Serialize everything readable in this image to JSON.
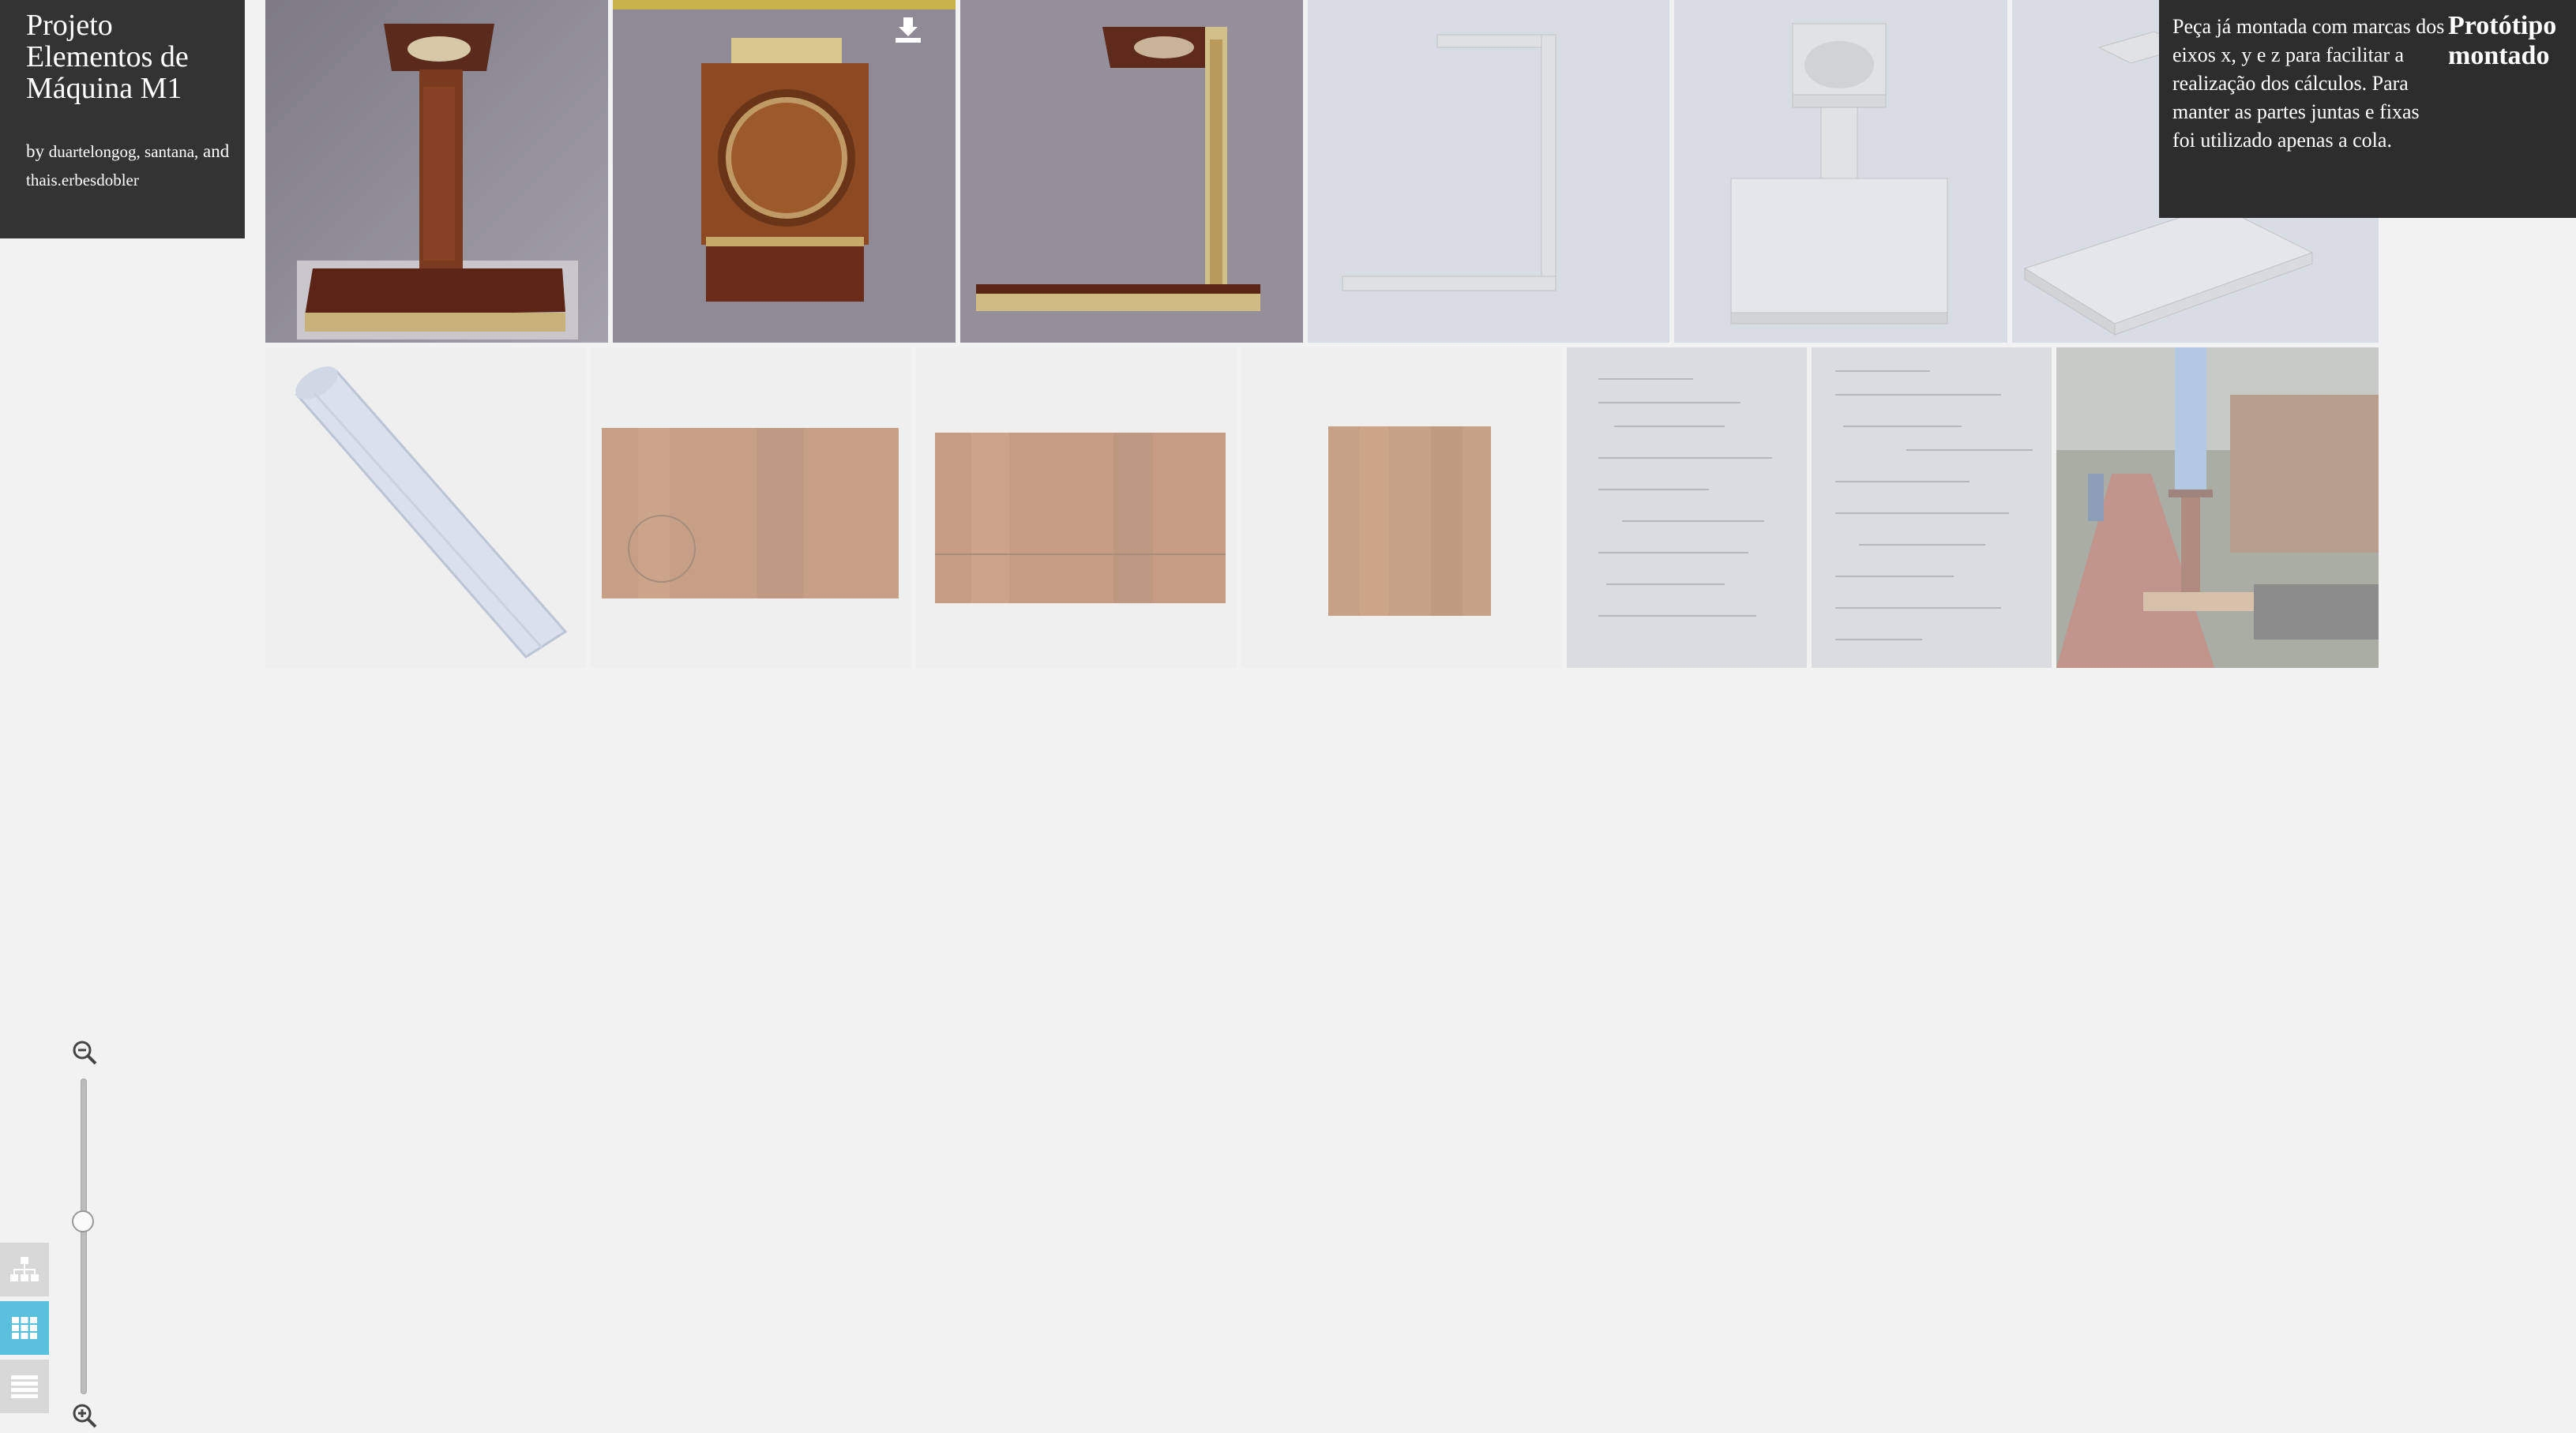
{
  "project": {
    "title": "Projeto Elementos de Máquina M1",
    "by_prefix": "by",
    "authors": "duartelongog, santana,",
    "and_word": "and",
    "last_author": "thais.erbesdobler"
  },
  "info": {
    "heading": "Protótipo montado",
    "description": "Peça já montada com marcas dos eixos x, y e z para facilitar a realização dos cálculos. Para manter as partes juntas e fixas foi utilizado apenas a cola."
  },
  "gallery": {
    "row1": [
      {
        "name": "photo-assembled-front",
        "active": true
      },
      {
        "name": "photo-assembled-top",
        "active": true
      },
      {
        "name": "photo-assembled-side",
        "active": true
      },
      {
        "name": "cad-side-view",
        "active": false
      },
      {
        "name": "cad-front-view",
        "active": false
      },
      {
        "name": "cad-iso-view",
        "active": false
      }
    ],
    "row2": [
      {
        "name": "photo-acrylic-tube",
        "active": false
      },
      {
        "name": "photo-wood-board-1",
        "active": false
      },
      {
        "name": "photo-wood-board-2",
        "active": false
      },
      {
        "name": "photo-wood-square",
        "active": false
      },
      {
        "name": "photo-calculations-1",
        "active": false
      },
      {
        "name": "photo-calculations-2",
        "active": false
      },
      {
        "name": "photo-outdoor-test",
        "active": false
      }
    ]
  },
  "controls": {
    "zoom_level": 0.45,
    "active_view": "grid"
  },
  "colors": {
    "panel_bg": "#333333",
    "accent_active_view": "#5bc0de",
    "page_bg": "#f2f2f2"
  }
}
